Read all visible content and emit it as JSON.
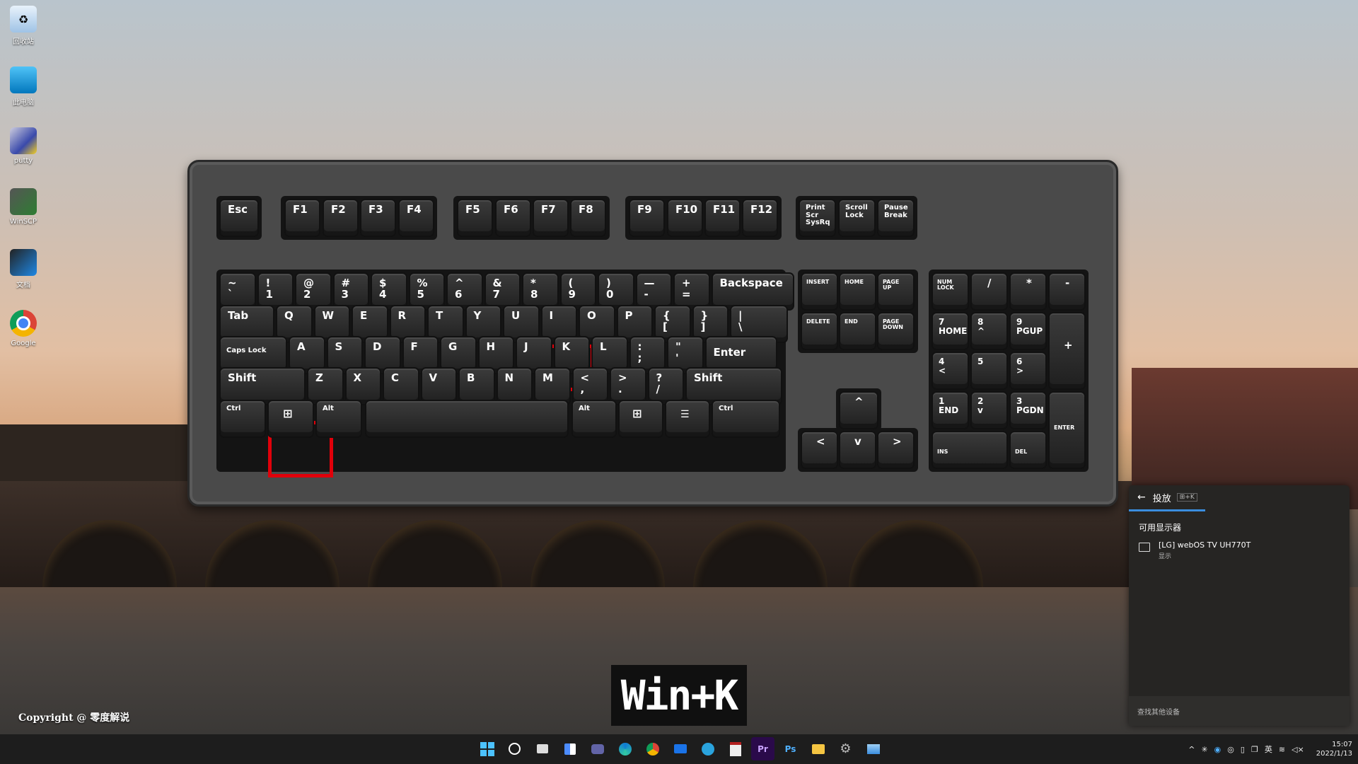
{
  "desktop": {
    "icons": [
      {
        "label": "回收站",
        "icon": "recycle-bin-icon"
      },
      {
        "label": "此电脑",
        "icon": "computer-icon"
      },
      {
        "label": "putty",
        "icon": "putty-icon"
      },
      {
        "label": "WinSCP",
        "icon": "winscp-icon"
      },
      {
        "label": "文档",
        "icon": "documents-icon"
      },
      {
        "label": "Google",
        "icon": "chrome-icon"
      }
    ],
    "copyright": "Copyright @ 零度解说"
  },
  "keyboard": {
    "fn_row": [
      "Esc",
      "F1",
      "F2",
      "F3",
      "F4",
      "F5",
      "F6",
      "F7",
      "F8",
      "F9",
      "F10",
      "F11",
      "F12"
    ],
    "sys_keys": [
      [
        "Print",
        "Scr",
        "SysRq"
      ],
      [
        "Scroll",
        "Lock"
      ],
      [
        "Pause",
        "Break"
      ]
    ],
    "number_row": [
      [
        "~",
        "`"
      ],
      [
        "!",
        "1"
      ],
      [
        "@",
        "2"
      ],
      [
        "#",
        "3"
      ],
      [
        "$",
        "4"
      ],
      [
        "%",
        "5"
      ],
      [
        "^",
        "6"
      ],
      [
        "&",
        "7"
      ],
      [
        "*",
        "8"
      ],
      [
        "(",
        "9"
      ],
      [
        ")",
        "0"
      ],
      [
        "—",
        "-"
      ],
      [
        "+",
        "="
      ]
    ],
    "backspace": "Backspace",
    "tab": "Tab",
    "qwerty_row": [
      "Q",
      "W",
      "E",
      "R",
      "T",
      "Y",
      "U",
      "I",
      "O",
      "P"
    ],
    "brackets": [
      [
        "{",
        "["
      ],
      [
        "}",
        "]"
      ],
      [
        "|",
        "\\"
      ]
    ],
    "caps": "Caps Lock",
    "home_row": [
      "A",
      "S",
      "D",
      "F",
      "G",
      "H",
      "J",
      "K",
      "L"
    ],
    "home_punct": [
      [
        ":",
        ";"
      ],
      [
        "\"",
        "'"
      ]
    ],
    "enter": "Enter",
    "shift": "Shift",
    "bottom_letters": [
      "Z",
      "X",
      "C",
      "V",
      "B",
      "N",
      "M"
    ],
    "bottom_punct": [
      [
        "<",
        ","
      ],
      [
        ">",
        "."
      ],
      [
        "?",
        "/"
      ]
    ],
    "ctrl": "Ctrl",
    "alt": "Alt",
    "nav_keys": [
      [
        "INSERT"
      ],
      [
        "HOME"
      ],
      [
        "PAGE",
        "UP"
      ],
      [
        "DELETE"
      ],
      [
        "END"
      ],
      [
        "PAGE",
        "DOWN"
      ]
    ],
    "arrows": [
      "^",
      "<",
      "v",
      ">"
    ],
    "numpad": {
      "numlock": [
        "NUM",
        "LOCK"
      ],
      "top": [
        "/",
        "*",
        "-"
      ],
      "plus": "+",
      "enter": "ENTER",
      "rows": [
        [
          [
            "7",
            "HOME"
          ],
          [
            "8",
            "^"
          ],
          [
            "9",
            "PGUP"
          ]
        ],
        [
          [
            "4",
            "<"
          ],
          [
            "5",
            ""
          ],
          [
            "6",
            ">"
          ]
        ],
        [
          [
            "1",
            "END"
          ],
          [
            "2",
            "v"
          ],
          [
            "3",
            "PGDN"
          ]
        ]
      ],
      "ins": "INS",
      "del": "DEL"
    },
    "highlight_keys": [
      "Win",
      "K"
    ]
  },
  "shortcut_label": "Win+K",
  "cast_panel": {
    "title": "投放",
    "shortcut_badge": "⊞+K",
    "section": "可用显示器",
    "device_name": "[LG] webOS TV UH770T",
    "device_sub": "显示",
    "footer": "查找其他设备"
  },
  "taskbar": {
    "apps": [
      "start-icon",
      "search-icon",
      "task-view-icon",
      "widgets-icon",
      "teams-icon",
      "edge-icon",
      "chrome-icon",
      "mail-icon",
      "telegram-icon",
      "calendar-icon",
      "premiere-icon",
      "photoshop-icon",
      "file-explorer-icon",
      "settings-icon",
      "photos-icon"
    ],
    "app_text": {
      "premiere": "Pr",
      "photoshop": "Ps"
    },
    "tray_lang": "英",
    "time": "15:07",
    "date": "2022/1/13"
  }
}
